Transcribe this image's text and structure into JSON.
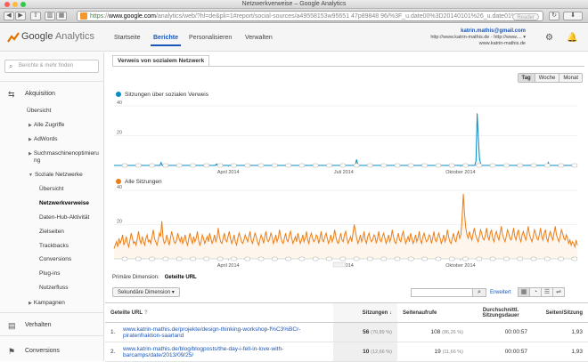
{
  "browser": {
    "window_title": "Netzwerkverweise – Google Analytics",
    "url_scheme": "https",
    "url_host": "www.google.com",
    "url_path": "/analytics/web/?hl=de&pli=1#report/social-sources/a49558153w95651 47p89848 96/%3F_u.date00%3D20140101%26_u.date01%3D201",
    "reader_label": "Reader"
  },
  "header": {
    "logo_google": "Google",
    "logo_analytics": "Analytics",
    "nav": [
      "Startseite",
      "Berichte",
      "Personalisieren",
      "Verwalten"
    ],
    "active_nav": "Berichte",
    "account_email": "katrin.mathis@gmail.com",
    "account_line2": "http://www.katrin-mathis.de - http://www.... ▾",
    "account_line3": "www.katrin-mathis.de"
  },
  "sidebar": {
    "search_placeholder": "Berichte & mehr finden",
    "akquisition": "Akquisition",
    "uebersicht": "Übersicht",
    "alle_zugriffe": "Alle Zugriffe",
    "adwords": "AdWords",
    "suchmaschinen_line1": "Suchmaschinenoptimieru",
    "suchmaschinen_line2": "ng",
    "soziale_netzwerke": "Soziale Netzwerke",
    "sub_uebersicht": "Übersicht",
    "netzwerkverweise": "Netzwerkverweise",
    "daten_hub": "Daten-Hub-Aktivität",
    "zielseiten": "Zielseiten",
    "trackbacks": "Trackbacks",
    "conversions": "Conversions",
    "plugins": "Plug-ins",
    "nutzerfluss": "Nutzerfluss",
    "kampagnen": "Kampagnen",
    "verhalten": "Verhalten",
    "conversions_main": "Conversions"
  },
  "report": {
    "tab": "Verweis von sozialem Netzwerk",
    "periods": [
      "Tag",
      "Woche",
      "Monat"
    ],
    "active_period": "Tag",
    "primary_dimension_label": "Primäre Dimension:",
    "primary_dimension_value": "Geteilte URL",
    "secondary_dimension": "Sekundäre Dimension ▾",
    "extended_label": "Erweitert"
  },
  "chart_data": [
    {
      "type": "line",
      "series": [
        {
          "name": "Sitzungen über sozialen Verweis",
          "color": "#058dc7"
        }
      ],
      "x_tick_labels": [
        "April 2014",
        "Juli 2014",
        "Oktober 2014"
      ],
      "y_tick_labels": [
        "40",
        "20"
      ],
      "ylim": [
        0,
        40
      ],
      "x_days": 365,
      "values": [
        0,
        0,
        0,
        0,
        0,
        0,
        0,
        0,
        0,
        0,
        0,
        0,
        0,
        0,
        0,
        0,
        0,
        0,
        0,
        0,
        0,
        0,
        0,
        0,
        0,
        0,
        0,
        0,
        0,
        0,
        0,
        0,
        0,
        0,
        0,
        0,
        0,
        0,
        0,
        2,
        0,
        0,
        0,
        0,
        0,
        0,
        0,
        0,
        0,
        0,
        0,
        0,
        0,
        0,
        0,
        0,
        0,
        0,
        0,
        0,
        0,
        0,
        0,
        0,
        0,
        0,
        0,
        0,
        0,
        0,
        0,
        0,
        0,
        0,
        0,
        0,
        0,
        0,
        0,
        0,
        0,
        0,
        0,
        0,
        0,
        1,
        0,
        0,
        0,
        0,
        0,
        0,
        0,
        0,
        0,
        0,
        0,
        0,
        0,
        0,
        0,
        0,
        0,
        0,
        0,
        0,
        0,
        0,
        0,
        0,
        0,
        0,
        0,
        0,
        0,
        0,
        0,
        0,
        0,
        0,
        0,
        0,
        0,
        0,
        0,
        0,
        0,
        0,
        0,
        0,
        0,
        0,
        0,
        0,
        0,
        0,
        0,
        0,
        0,
        0,
        0,
        0,
        0,
        0,
        0,
        0,
        0,
        0,
        0,
        0,
        0,
        0,
        0,
        0,
        0,
        0,
        0,
        0,
        0,
        0,
        0,
        0,
        0,
        0,
        0,
        0,
        0,
        0,
        0,
        0,
        0,
        0,
        0,
        0,
        0,
        0,
        0,
        0,
        0,
        0,
        0,
        0,
        0,
        0,
        0,
        0,
        0,
        0,
        0,
        0,
        0,
        0,
        0,
        0,
        0,
        0,
        0,
        0,
        0,
        0,
        0,
        4,
        1,
        0,
        0,
        0,
        0,
        0,
        0,
        0,
        0,
        0,
        0,
        0,
        0,
        0,
        0,
        0,
        0,
        0,
        0,
        0,
        0,
        0,
        0,
        0,
        0,
        0,
        0,
        0,
        0,
        0,
        0,
        0,
        0,
        0,
        0,
        0,
        0,
        0,
        0,
        0,
        0,
        0,
        0,
        0,
        0,
        0,
        0,
        0,
        0,
        0,
        0,
        0,
        0,
        0,
        0,
        0,
        0,
        0,
        0,
        0,
        0,
        0,
        0,
        0,
        0,
        0,
        0,
        0,
        0,
        0,
        0,
        0,
        0,
        0,
        0,
        0,
        0,
        0,
        0,
        0,
        0,
        0,
        0,
        0,
        0,
        0,
        0,
        0,
        0,
        0,
        0,
        0,
        0,
        0,
        0,
        0,
        0,
        0,
        3,
        35,
        18,
        4,
        1,
        0,
        0,
        0,
        0,
        0,
        0,
        0,
        0,
        0,
        0,
        0,
        0,
        0,
        0,
        0,
        0,
        0,
        0,
        0,
        0,
        0,
        0,
        0,
        0,
        0,
        0,
        0,
        0,
        0,
        0,
        0,
        0,
        0,
        0,
        0,
        0,
        0,
        0,
        0,
        0,
        0,
        0,
        0,
        0,
        0,
        0,
        0,
        0,
        0,
        0,
        0,
        0,
        0,
        0,
        0,
        2,
        0,
        0,
        0,
        0,
        0,
        0,
        0,
        0,
        0,
        0,
        0,
        0,
        0,
        0,
        0,
        0,
        0,
        0,
        0,
        0,
        0,
        0,
        0,
        0
      ]
    },
    {
      "type": "line",
      "series": [
        {
          "name": "Alle Sitzungen",
          "color": "#ed7e17"
        }
      ],
      "x_tick_labels": [
        "April 2014",
        "Juli 2014",
        "Oktober 2014"
      ],
      "y_tick_labels": [
        "40",
        "20"
      ],
      "ylim": [
        0,
        40
      ],
      "x_days": 365,
      "values": [
        6,
        8,
        10,
        7,
        12,
        9,
        11,
        14,
        8,
        10,
        13,
        9,
        7,
        11,
        15,
        12,
        9,
        10,
        8,
        12,
        16,
        11,
        9,
        13,
        10,
        8,
        12,
        14,
        10,
        11,
        9,
        13,
        17,
        12,
        10,
        8,
        11,
        15,
        13,
        22,
        12,
        9,
        10,
        14,
        11,
        8,
        12,
        16,
        13,
        10,
        9,
        11,
        15,
        12,
        10,
        13,
        9,
        11,
        14,
        10,
        8,
        12,
        15,
        11,
        9,
        13,
        10,
        12,
        16,
        11,
        8,
        10,
        14,
        12,
        9,
        11,
        13,
        10,
        15,
        12,
        9,
        11,
        14,
        10,
        12,
        18,
        13,
        10,
        9,
        12,
        15,
        11,
        10,
        13,
        16,
        12,
        9,
        11,
        14,
        10,
        8,
        12,
        15,
        13,
        10,
        9,
        11,
        14,
        12,
        10,
        13,
        16,
        11,
        9,
        12,
        15,
        13,
        10,
        8,
        11,
        14,
        12,
        9,
        13,
        16,
        11,
        10,
        12,
        15,
        13,
        9,
        11,
        14,
        10,
        12,
        17,
        13,
        10,
        9,
        12,
        15,
        11,
        10,
        14,
        16,
        12,
        9,
        11,
        13,
        10,
        15,
        12,
        9,
        11,
        14,
        10,
        12,
        16,
        11,
        9,
        13,
        15,
        12,
        10,
        11,
        14,
        13,
        9,
        12,
        16,
        11,
        10,
        13,
        15,
        12,
        9,
        11,
        14,
        10,
        12,
        17,
        13,
        10,
        9,
        12,
        15,
        11,
        10,
        14,
        16,
        12,
        9,
        11,
        13,
        10,
        15,
        20,
        16,
        12,
        9,
        11,
        14,
        10,
        12,
        16,
        11,
        9,
        13,
        15,
        12,
        10,
        11,
        14,
        13,
        9,
        12,
        16,
        11,
        10,
        13,
        15,
        12,
        9,
        11,
        14,
        10,
        12,
        17,
        13,
        10,
        9,
        12,
        15,
        11,
        10,
        14,
        16,
        12,
        9,
        11,
        13,
        10,
        15,
        12,
        9,
        11,
        14,
        10,
        12,
        16,
        11,
        9,
        13,
        15,
        12,
        10,
        11,
        14,
        13,
        9,
        12,
        16,
        11,
        10,
        13,
        15,
        12,
        9,
        11,
        14,
        10,
        12,
        17,
        13,
        10,
        9,
        12,
        15,
        11,
        10,
        14,
        16,
        12,
        14,
        24,
        38,
        26,
        18,
        14,
        12,
        16,
        13,
        11,
        15,
        18,
        14,
        12,
        10,
        13,
        17,
        15,
        12,
        11,
        14,
        18,
        13,
        11,
        15,
        17,
        12,
        10,
        14,
        16,
        13,
        11,
        15,
        19,
        14,
        12,
        10,
        13,
        17,
        15,
        12,
        11,
        14,
        18,
        13,
        11,
        15,
        17,
        12,
        10,
        14,
        16,
        13,
        11,
        15,
        19,
        14,
        12,
        10,
        13,
        17,
        15,
        12,
        11,
        14,
        18,
        13,
        11,
        15,
        17,
        12,
        10,
        14,
        16,
        13,
        11,
        15,
        19,
        14,
        12,
        10,
        13,
        17,
        15,
        12,
        11,
        14,
        12,
        9,
        11,
        8,
        10,
        9,
        7,
        11,
        8
      ]
    }
  ],
  "table": {
    "headers": {
      "url": "Geteilte URL",
      "sessions": "Sitzungen",
      "pageviews": "Seitenaufrufe",
      "duration": "Durchschnittl. Sitzungsdauer",
      "pages": "Seiten/Sitzung"
    },
    "rows": [
      {
        "idx": "1.",
        "url_line1": "www.katrin-mathis.de/projekte/design-thinking-workshop-f%C3%BCr-",
        "url_line2": "piratenfraktion-saarland",
        "sessions": "56",
        "sessions_pct": "(70,89 %)",
        "pageviews": "108",
        "pageviews_pct": "(86,26 %)",
        "duration": "00:00:57",
        "pages": "1,93"
      },
      {
        "idx": "2.",
        "url_line1": "www.katrin-mathis.de/blog/blogposts/the-day-i-fell-in-love-with-",
        "url_line2": "barcamps/date/2013/09/25/",
        "sessions": "10",
        "sessions_pct": "(12,66 %)",
        "pageviews": "19",
        "pageviews_pct": "(11,66 %)",
        "duration": "00:00:57",
        "pages": "1,93"
      }
    ]
  }
}
